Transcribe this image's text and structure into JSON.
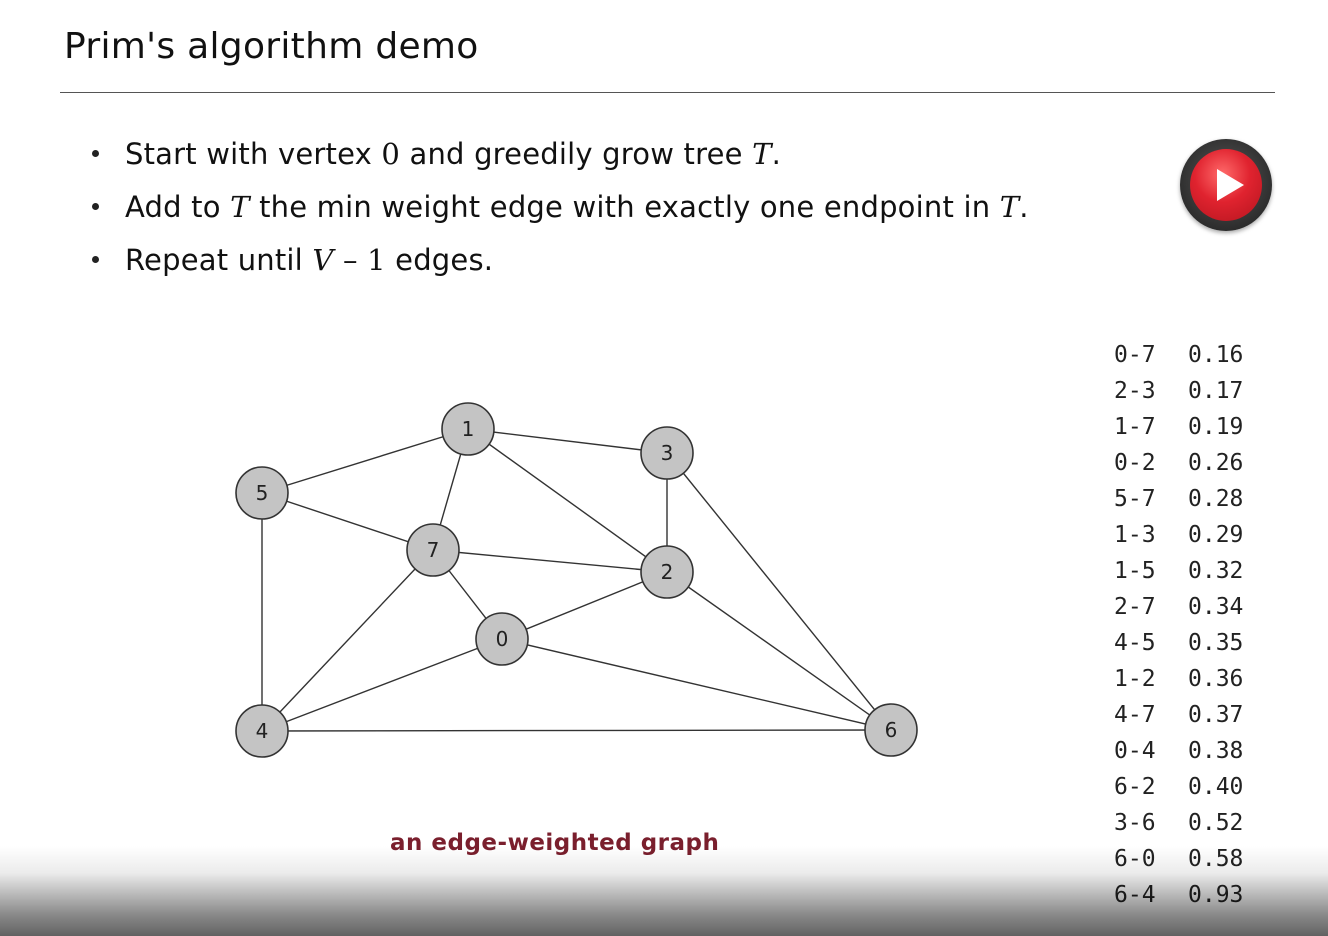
{
  "slide": {
    "title": "Prim's algorithm demo",
    "bullets": [
      {
        "pre": "Start with vertex ",
        "m1": "0",
        "mid": " and greedily grow tree ",
        "m2": "T",
        "post": "."
      },
      {
        "pre": "Add to ",
        "m1": "T",
        "mid": " the min weight edge with exactly one endpoint in ",
        "m2": "T",
        "post": "."
      },
      {
        "pre": "Repeat until ",
        "m1": "V",
        "mid": " – ",
        "m2": "1",
        "post": " edges."
      }
    ],
    "play_icon": "play-icon",
    "accent_color": "#e0232f",
    "caption": "an edge-weighted graph",
    "caption_color": "#7a1f2d"
  },
  "graph": {
    "vertices": [
      {
        "id": "0"
      },
      {
        "id": "1"
      },
      {
        "id": "2"
      },
      {
        "id": "3"
      },
      {
        "id": "4"
      },
      {
        "id": "5"
      },
      {
        "id": "6"
      },
      {
        "id": "7"
      }
    ],
    "edges": [
      {
        "label": "0-7",
        "weight": "0.16"
      },
      {
        "label": "2-3",
        "weight": "0.17"
      },
      {
        "label": "1-7",
        "weight": "0.19"
      },
      {
        "label": "0-2",
        "weight": "0.26"
      },
      {
        "label": "5-7",
        "weight": "0.28"
      },
      {
        "label": "1-3",
        "weight": "0.29"
      },
      {
        "label": "1-5",
        "weight": "0.32"
      },
      {
        "label": "2-7",
        "weight": "0.34"
      },
      {
        "label": "4-5",
        "weight": "0.35"
      },
      {
        "label": "1-2",
        "weight": "0.36"
      },
      {
        "label": "4-7",
        "weight": "0.37"
      },
      {
        "label": "0-4",
        "weight": "0.38"
      },
      {
        "label": "6-2",
        "weight": "0.40"
      },
      {
        "label": "3-6",
        "weight": "0.52"
      },
      {
        "label": "6-0",
        "weight": "0.58"
      },
      {
        "label": "6-4",
        "weight": "0.93"
      }
    ]
  }
}
